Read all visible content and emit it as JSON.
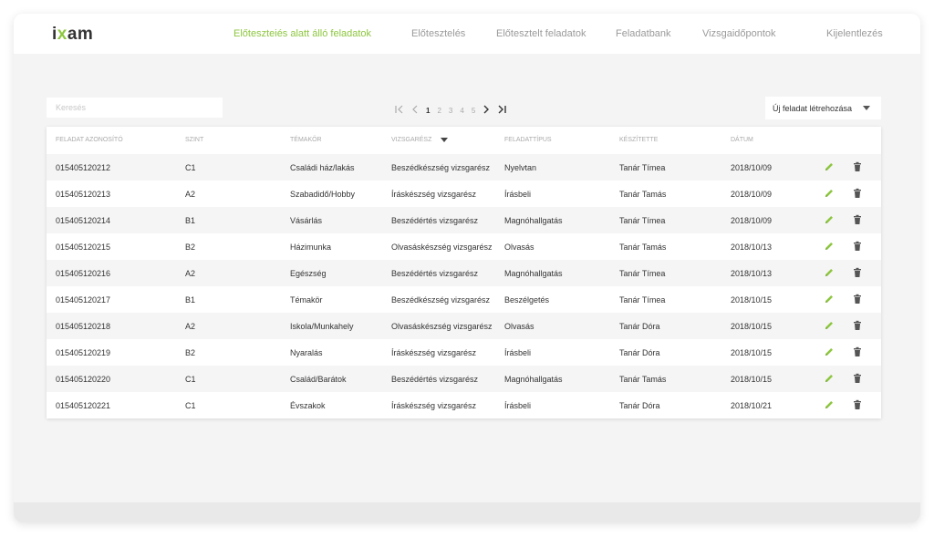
{
  "brand": {
    "logo_prefix": "i",
    "logo_x": "x",
    "logo_suffix": "am"
  },
  "nav": {
    "items": [
      {
        "label": "Előteszteiés alatt álló feladatok",
        "active": true
      },
      {
        "label": "Előtesztelés",
        "active": false
      },
      {
        "label": "Előtesztelt feladatok",
        "active": false
      },
      {
        "label": "Feladatbank",
        "active": false
      },
      {
        "label": "Vizsgaidőpontok",
        "active": false
      },
      {
        "label": "Kijelentlezés",
        "active": false
      }
    ]
  },
  "colors": {
    "accent": "#8dc63f",
    "stripe": "#f5f5f5",
    "background": "#f4f4f4"
  },
  "search": {
    "placeholder": "Keresés",
    "value": ""
  },
  "pagination": {
    "first_icon": "first-page-icon",
    "prev_icon": "prev-page-icon",
    "pages": [
      "1",
      "2",
      "3",
      "4",
      "5"
    ],
    "current": "1",
    "next_icon": "next-page-icon",
    "last_icon": "last-page-icon"
  },
  "new_task": {
    "label": "Új feladat létrehozása",
    "icon": "caret-down-icon"
  },
  "table": {
    "columns": [
      "Feladat azonosító",
      "Szint",
      "Témakör",
      "Vizsgarész",
      "Feladattípus",
      "Készítette",
      "Dátum"
    ],
    "sort_icon": "sort-caret-icon",
    "rows": [
      [
        "015405120212",
        "C1",
        "Családi ház/lakás",
        "Beszédkészség vizsgarész",
        "Nyelvtan",
        "Tanár Tímea",
        "2018/10/09"
      ],
      [
        "015405120213",
        "A2",
        "Szabadidő/Hobby",
        "Íráskészség vizsgarész",
        "Írásbeli",
        "Tanár Tamás",
        "2018/10/09"
      ],
      [
        "015405120214",
        "B1",
        "Vásárlás",
        "Beszédértés vizsgarész",
        "Magnóhallgatás",
        "Tanár Tímea",
        "2018/10/09"
      ],
      [
        "015405120215",
        "B2",
        "Házimunka",
        "Olvasáskészség vizsgarész",
        "Olvasás",
        "Tanár Tamás",
        "2018/10/13"
      ],
      [
        "015405120216",
        "A2",
        "Egészség",
        "Beszédértés vizsgarész",
        "Magnóhallgatás",
        "Tanár Tímea",
        "2018/10/13"
      ],
      [
        "015405120217",
        "B1",
        "Témakör",
        "Beszédkészség vizsgarész",
        "Beszélgetés",
        "Tanár Tímea",
        "2018/10/15"
      ],
      [
        "015405120218",
        "A2",
        "Iskola/Munkahely",
        "Olvasáskészség vizsgarész",
        "Olvasás",
        "Tanár Dóra",
        "2018/10/15"
      ],
      [
        "015405120219",
        "B2",
        "Nyaralás",
        "Íráskészség vizsgarész",
        "Írásbeli",
        "Tanár Dóra",
        "2018/10/15"
      ],
      [
        "015405120220",
        "C1",
        "Család/Barátok",
        "Beszédértés vizsgarész",
        "Magnóhallgatás",
        "Tanár Tamás",
        "2018/10/15"
      ],
      [
        "015405120221",
        "C1",
        "Évszakok",
        "Íráskészség vizsgarész",
        "Írásbeli",
        "Tanár Dóra",
        "2018/10/21"
      ]
    ],
    "row_actions": {
      "edit_icon": "pencil-icon",
      "delete_icon": "trash-icon"
    }
  }
}
